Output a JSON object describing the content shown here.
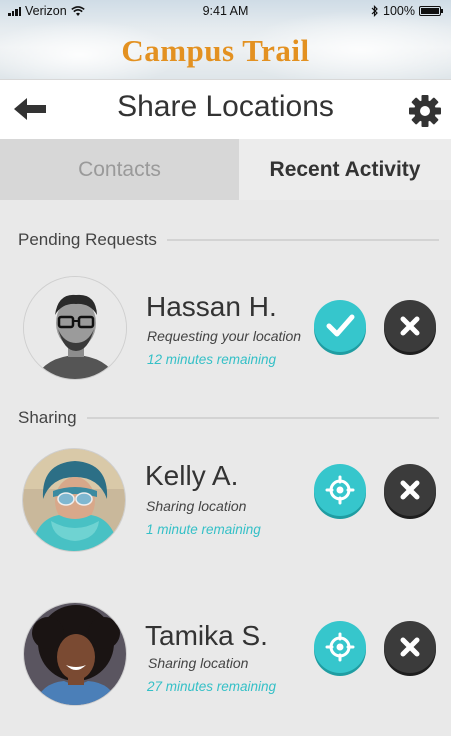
{
  "status_bar": {
    "carrier": "Verizon",
    "time": "9:41 AM",
    "battery": "100%"
  },
  "app": {
    "title": "Campus Trail"
  },
  "header": {
    "title": "Share Locations",
    "back_icon": "arrow-left-icon",
    "settings_icon": "gear-icon"
  },
  "tabs": [
    {
      "label": "Contacts",
      "active": false
    },
    {
      "label": "Recent Activity",
      "active": true
    }
  ],
  "sections": {
    "pending": {
      "label": "Pending Requests",
      "items": [
        {
          "name": "Hassan H.",
          "status": "Requesting your location",
          "remaining": "12 minutes remaining",
          "accept_icon": "checkmark-icon",
          "decline_icon": "close-icon"
        }
      ]
    },
    "sharing": {
      "label": "Sharing",
      "items": [
        {
          "name": "Kelly A.",
          "status": "Sharing location",
          "remaining": "1 minute remaining",
          "locate_icon": "crosshair-icon",
          "stop_icon": "close-icon"
        },
        {
          "name": "Tamika S.",
          "status": "Sharing location",
          "remaining": "27 minutes remaining",
          "locate_icon": "crosshair-icon",
          "stop_icon": "close-icon"
        }
      ]
    }
  },
  "colors": {
    "accent": "#36c6cc",
    "title": "#e39121",
    "dark_button": "#3b3b3b"
  }
}
